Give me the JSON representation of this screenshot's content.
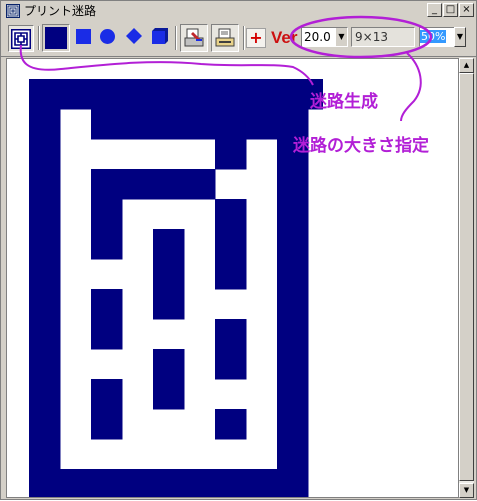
{
  "window": {
    "title": "プリント迷路"
  },
  "title_buttons": {
    "minimize": "_",
    "maximize": "□",
    "close": "×"
  },
  "toolbar": {
    "generate_icon": "maze-icon",
    "fill_color": "#000080",
    "shapes": [
      "square",
      "circle",
      "diamond",
      "cube"
    ],
    "print_icons": [
      "print-edit-icon",
      "print-preview-icon"
    ],
    "add_label": "+",
    "version_label": "Ver",
    "cell_size": "20.0",
    "maze_size": "9×13",
    "zoom": "50%"
  },
  "annotations": {
    "generate": "迷路生成",
    "size": "迷路の大きさ指定",
    "color": "#b21fd6"
  },
  "maze": {
    "columns": 9,
    "rows": 13,
    "wall_color": "#000080",
    "path_color": "#ffffff",
    "grid": [
      "##########",
      "#.#######",
      "#.....#.#",
      "#.####..#",
      "#.#...#.#",
      "#.#.#.#.#",
      "#...#.#.#",
      "#.#.#...#",
      "#.#...#.#",
      "#...#.#.#",
      "#.#.#...#",
      "#.#...#.#",
      "#.......#",
      "#########"
    ]
  }
}
